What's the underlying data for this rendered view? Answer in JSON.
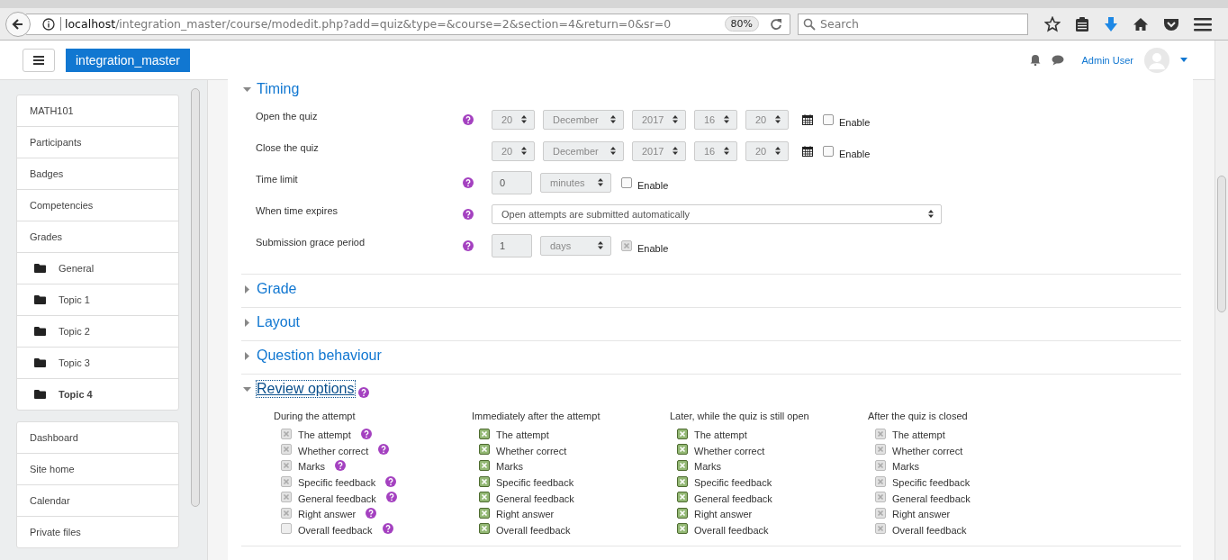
{
  "browser": {
    "url_host": "localhost",
    "url_path": "/integration_master/course/modedit.php?add=quiz&type=&course=2&section=4&return=0&sr=0",
    "zoom": "80%",
    "search_placeholder": "Search"
  },
  "navbar": {
    "site_name": "integration_master",
    "user_name": "Admin User"
  },
  "sidebar": {
    "groups": [
      {
        "items": [
          {
            "label": "MATH101",
            "kind": "link",
            "selected": false
          },
          {
            "label": "Participants",
            "kind": "link",
            "selected": false
          },
          {
            "label": "Badges",
            "kind": "link",
            "selected": false
          },
          {
            "label": "Competencies",
            "kind": "link",
            "selected": false
          },
          {
            "label": "Grades",
            "kind": "link",
            "selected": false
          },
          {
            "label": "General",
            "kind": "folder",
            "selected": false
          },
          {
            "label": "Topic 1",
            "kind": "folder",
            "selected": false
          },
          {
            "label": "Topic 2",
            "kind": "folder",
            "selected": false
          },
          {
            "label": "Topic 3",
            "kind": "folder",
            "selected": false
          },
          {
            "label": "Topic 4",
            "kind": "folder",
            "selected": true
          }
        ]
      },
      {
        "items": [
          {
            "label": "Dashboard",
            "kind": "link",
            "selected": false
          },
          {
            "label": "Site home",
            "kind": "link",
            "selected": false
          },
          {
            "label": "Calendar",
            "kind": "link",
            "selected": false
          },
          {
            "label": "Private files",
            "kind": "link",
            "selected": false
          }
        ]
      }
    ]
  },
  "sections": [
    {
      "title": "Timing",
      "expanded": true,
      "help": false,
      "fields": [
        {
          "label": "Open the quiz",
          "help": true,
          "kind": "datetime",
          "parts": [
            "20",
            "December",
            "2017",
            "16",
            "20"
          ],
          "enable": {
            "label": "Enable",
            "checked": false,
            "disabled": false
          }
        },
        {
          "label": "Close the quiz",
          "help": false,
          "kind": "datetime",
          "parts": [
            "20",
            "December",
            "2017",
            "16",
            "20"
          ],
          "enable": {
            "label": "Enable",
            "checked": false,
            "disabled": false
          }
        },
        {
          "label": "Time limit",
          "help": true,
          "kind": "duration",
          "value": "0",
          "unit": "minutes",
          "enable": {
            "label": "Enable",
            "checked": false,
            "disabled": false
          }
        },
        {
          "label": "When time expires",
          "help": true,
          "kind": "select",
          "value": "Open attempts are submitted automatically"
        },
        {
          "label": "Submission grace period",
          "help": true,
          "kind": "duration",
          "value": "1",
          "unit": "days",
          "enable": {
            "label": "Enable",
            "checked": true,
            "disabled": true
          }
        }
      ]
    },
    {
      "title": "Grade",
      "expanded": false,
      "help": false
    },
    {
      "title": "Layout",
      "expanded": false,
      "help": false
    },
    {
      "title": "Question behaviour",
      "expanded": false,
      "help": false
    },
    {
      "title": "Review options",
      "expanded": true,
      "help": true,
      "review_columns": [
        {
          "heading": "During the attempt",
          "options": [
            {
              "label": "The attempt",
              "checked": true,
              "disabled": true,
              "help": true
            },
            {
              "label": "Whether correct",
              "checked": true,
              "disabled": true,
              "help": true
            },
            {
              "label": "Marks",
              "checked": true,
              "disabled": true,
              "help": true
            },
            {
              "label": "Specific feedback",
              "checked": true,
              "disabled": true,
              "help": true
            },
            {
              "label": "General feedback",
              "checked": true,
              "disabled": true,
              "help": true
            },
            {
              "label": "Right answer",
              "checked": true,
              "disabled": true,
              "help": true
            },
            {
              "label": "Overall feedback",
              "checked": false,
              "disabled": true,
              "help": true
            }
          ]
        },
        {
          "heading": "Immediately after the attempt",
          "options": [
            {
              "label": "The attempt",
              "checked": true,
              "disabled": false,
              "help": false
            },
            {
              "label": "Whether correct",
              "checked": true,
              "disabled": false,
              "help": false
            },
            {
              "label": "Marks",
              "checked": true,
              "disabled": false,
              "help": false
            },
            {
              "label": "Specific feedback",
              "checked": true,
              "disabled": false,
              "help": false
            },
            {
              "label": "General feedback",
              "checked": true,
              "disabled": false,
              "help": false
            },
            {
              "label": "Right answer",
              "checked": true,
              "disabled": false,
              "help": false
            },
            {
              "label": "Overall feedback",
              "checked": true,
              "disabled": false,
              "help": false
            }
          ]
        },
        {
          "heading": "Later, while the quiz is still open",
          "options": [
            {
              "label": "The attempt",
              "checked": true,
              "disabled": false,
              "help": false
            },
            {
              "label": "Whether correct",
              "checked": true,
              "disabled": false,
              "help": false
            },
            {
              "label": "Marks",
              "checked": true,
              "disabled": false,
              "help": false
            },
            {
              "label": "Specific feedback",
              "checked": true,
              "disabled": false,
              "help": false
            },
            {
              "label": "General feedback",
              "checked": true,
              "disabled": false,
              "help": false
            },
            {
              "label": "Right answer",
              "checked": true,
              "disabled": false,
              "help": false
            },
            {
              "label": "Overall feedback",
              "checked": true,
              "disabled": false,
              "help": false
            }
          ]
        },
        {
          "heading": "After the quiz is closed",
          "options": [
            {
              "label": "The attempt",
              "checked": true,
              "disabled": true,
              "help": false
            },
            {
              "label": "Whether correct",
              "checked": true,
              "disabled": true,
              "help": false
            },
            {
              "label": "Marks",
              "checked": true,
              "disabled": true,
              "help": false
            },
            {
              "label": "Specific feedback",
              "checked": true,
              "disabled": true,
              "help": false
            },
            {
              "label": "General feedback",
              "checked": true,
              "disabled": true,
              "help": false
            },
            {
              "label": "Right answer",
              "checked": true,
              "disabled": true,
              "help": false
            },
            {
              "label": "Overall feedback",
              "checked": true,
              "disabled": true,
              "help": false
            }
          ]
        }
      ]
    }
  ]
}
